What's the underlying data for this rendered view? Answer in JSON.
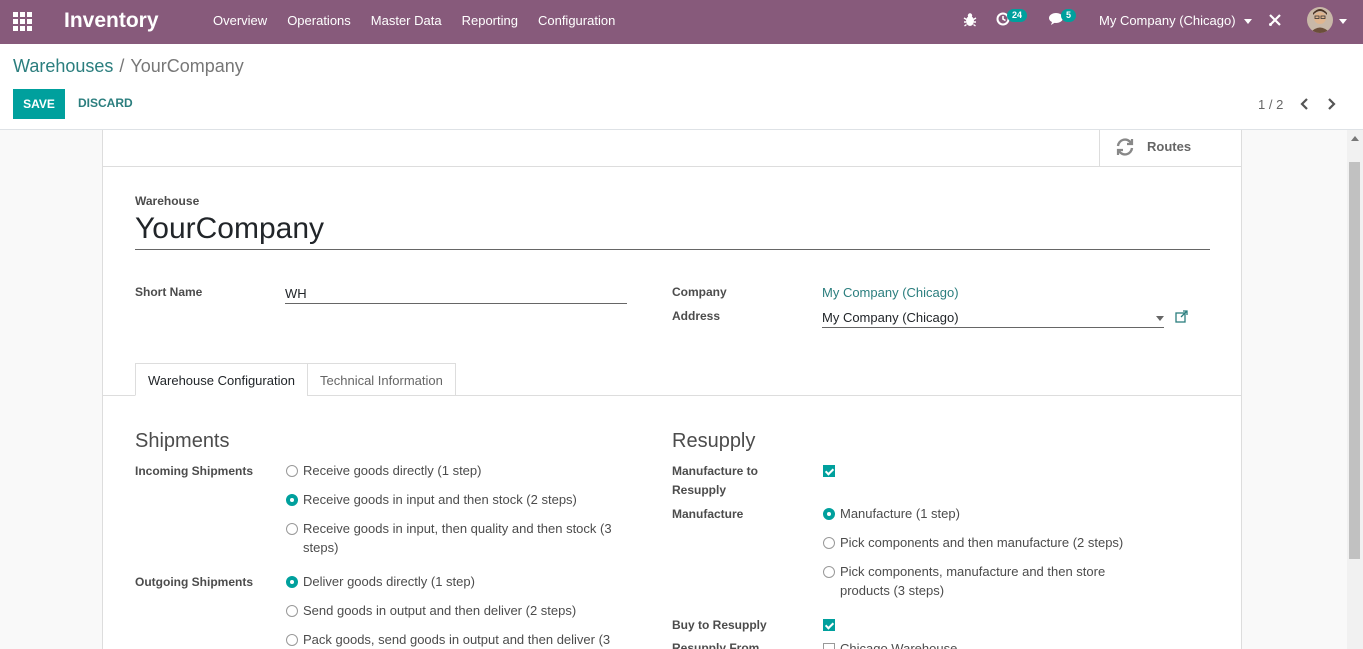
{
  "navbar": {
    "app_name": "Inventory",
    "menu": [
      "Overview",
      "Operations",
      "Master Data",
      "Reporting",
      "Configuration"
    ],
    "activity_count": "24",
    "message_count": "5",
    "company": "My Company (Chicago)",
    "brand_color": "#875a7b"
  },
  "control": {
    "breadcrumb_parent": "Warehouses",
    "breadcrumb_current": "YourCompany",
    "save_label": "SAVE",
    "discard_label": "DISCARD",
    "pager": "1 / 2"
  },
  "sheet": {
    "routes_label": "Routes",
    "warehouse_label": "Warehouse",
    "warehouse_name": "YourCompany",
    "short_name_label": "Short Name",
    "short_name_value": "WH",
    "company_label": "Company",
    "company_value": "My Company (Chicago)",
    "address_label": "Address",
    "address_value": "My Company (Chicago)"
  },
  "tabs": [
    "Warehouse Configuration",
    "Technical Information"
  ],
  "shipments": {
    "title": "Shipments",
    "incoming_label": "Incoming Shipments",
    "incoming_options": [
      {
        "label": "Receive goods directly (1 step)",
        "checked": false
      },
      {
        "label": "Receive goods in input and then stock (2 steps)",
        "checked": true
      },
      {
        "label_line1": "Receive goods in input, then quality and then stock (3",
        "label_line2": "steps)",
        "checked": false
      }
    ],
    "outgoing_label": "Outgoing Shipments",
    "outgoing_options": [
      {
        "label": "Deliver goods directly (1 step)",
        "checked": true
      },
      {
        "label": "Send goods in output and then deliver (2 steps)",
        "checked": false
      },
      {
        "label": "Pack goods, send goods in output and then deliver (3",
        "checked": false
      }
    ]
  },
  "resupply": {
    "title": "Resupply",
    "manufacture_to_resupply_line1": "Manufacture to",
    "manufacture_to_resupply_line2": "Resupply",
    "manufacture_to_resupply_checked": true,
    "manufacture_label": "Manufacture",
    "manufacture_options": [
      {
        "label": "Manufacture (1 step)",
        "checked": true
      },
      {
        "label": "Pick components and then manufacture (2 steps)",
        "checked": false
      },
      {
        "label_line1": "Pick components, manufacture and then store",
        "label_line2": "products (3 steps)",
        "checked": false
      }
    ],
    "buy_to_resupply_label": "Buy to Resupply",
    "buy_to_resupply_checked": true,
    "resupply_from_label": "Resupply From",
    "resupply_from_option": "Chicago Warehouse"
  }
}
